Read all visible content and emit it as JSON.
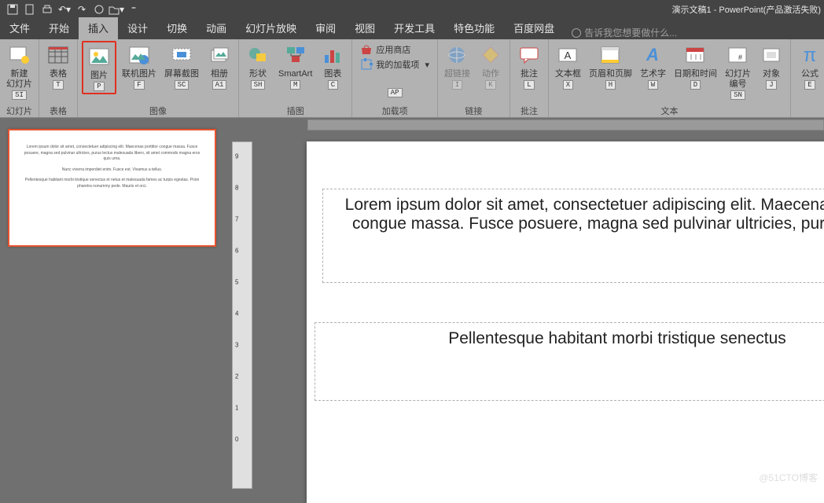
{
  "title": "演示文稿1 - PowerPoint(产品激活失败)",
  "qat": [
    "save",
    "new",
    "print",
    "undo",
    "redo",
    "touch",
    "open",
    "more"
  ],
  "tabs": [
    "文件",
    "开始",
    "插入",
    "设计",
    "切换",
    "动画",
    "幻灯片放映",
    "审阅",
    "视图",
    "开发工具",
    "特色功能",
    "百度网盘"
  ],
  "active_tab": 2,
  "addins_supertab": "AS",
  "tell_me_placeholder": "告诉我您想要做什么...",
  "groups": {
    "slides": {
      "label": "幻灯片",
      "new_slide": "新建\n幻灯片",
      "key": "SI"
    },
    "tables": {
      "label": "表格",
      "btn": "表格",
      "key": "T"
    },
    "images": {
      "label": "图像",
      "picture": "图片",
      "picture_key": "P",
      "online_pic": "联机图片",
      "online_key": "F",
      "screenshot": "屏幕截图",
      "screenshot_key": "SC",
      "album": "相册",
      "album_key": "A1"
    },
    "illus": {
      "label": "插图",
      "shapes": "形状",
      "shapes_key": "SH",
      "smartart": "SmartArt",
      "smartart_key": "M",
      "chart": "图表",
      "chart_key": "C"
    },
    "addins": {
      "label": "加载项",
      "store": "应用商店",
      "my_addins": "我的加载项",
      "key": "AP"
    },
    "links": {
      "label": "链接",
      "hyperlink": "超链接",
      "hyperlink_key": "I",
      "action": "动作",
      "action_key": "K"
    },
    "comments": {
      "label": "批注",
      "comment": "批注",
      "key": "L"
    },
    "text": {
      "label": "文本",
      "textbox": "文本框",
      "textbox_key": "X",
      "header_footer": "页眉和页脚",
      "hf_key": "H",
      "wordart": "艺术字",
      "wa_key": "W",
      "date_time": "日期和时间",
      "dt_key": "D",
      "slide_num": "幻灯片\n编号",
      "sn_key": "SN",
      "object": "对象",
      "obj_key": "J"
    },
    "formula": {
      "btn": "公式",
      "key": "E"
    }
  },
  "vruler_ticks": [
    "9",
    "8",
    "7",
    "6",
    "5",
    "4",
    "3",
    "2",
    "1",
    "0"
  ],
  "slide_content": {
    "p1": "Lorem ipsum dolor sit amet, consectetuer adipiscing elit. Maecenas porttitor congue massa. Fusce posuere, magna sed pulvinar ultricies, purus lectus malesuada libero, sit amet commodo magna eros quis urna.",
    "p2": "Nunc viverra imperdiet enim. Fusce est. Vivamus a tellus.",
    "p3": "Pellentesque habitant morbi tristique senectus et netus et malesuada fames ac turpis egestas. Proin pharetra nonummy pede. Mauris et orci.",
    "main1": "Lorem ipsum dolor sit amet, consectetuer adipiscing elit. Maecenas porttitor congue massa. Fusce posuere, magna sed pulvinar ultricies, purus lectus",
    "main2": "Pellentesque habitant morbi tristique senectus"
  },
  "watermark": "@51CTO博客"
}
